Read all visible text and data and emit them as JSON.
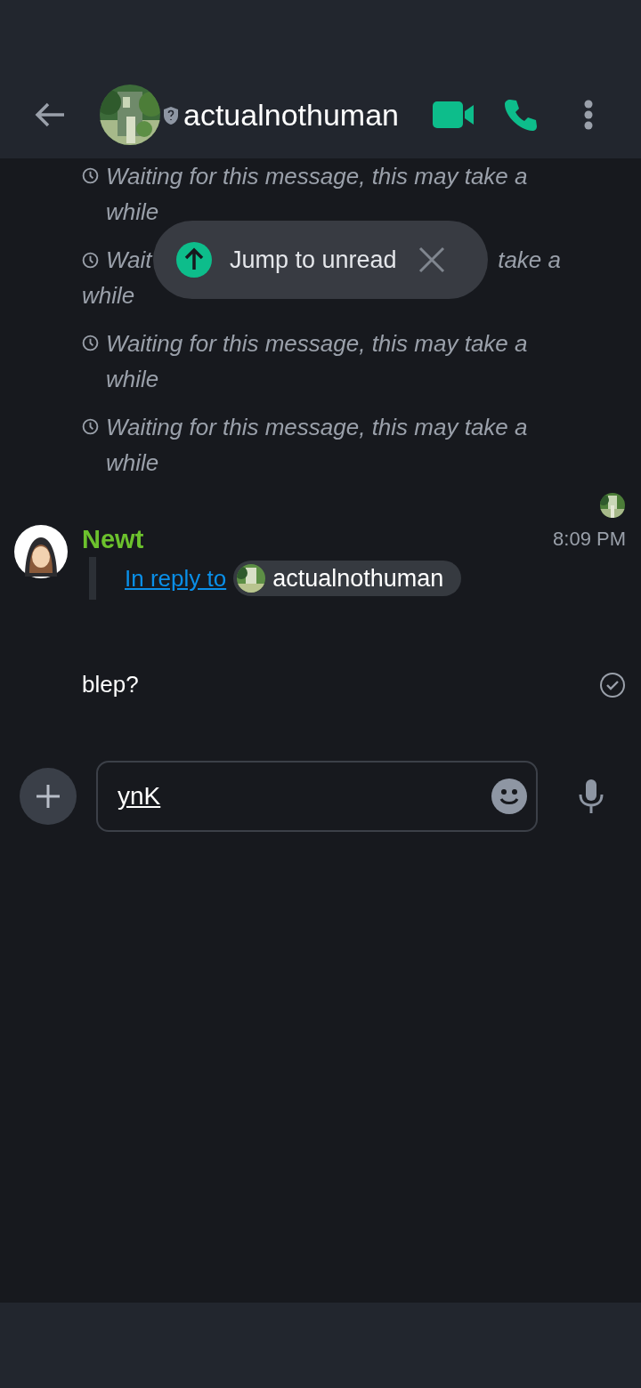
{
  "header": {
    "title": "actualnothuman"
  },
  "toast": {
    "label": "Jump to unread"
  },
  "pending_messages": [
    {
      "kind": "full",
      "text": "Waiting for this message, this may take a while"
    },
    {
      "kind": "covered",
      "start": "Wait",
      "end": "take a",
      "line_2": "while"
    },
    {
      "kind": "full",
      "text": "Waiting for this message, this may take a while"
    },
    {
      "kind": "full",
      "text": "Waiting for this message, this may take a while"
    }
  ],
  "message": {
    "sender": "Newt",
    "time": "8:09 PM",
    "reply": {
      "link": "In reply to",
      "user": "actualnothuman"
    },
    "body": "blep?",
    "sent": true
  },
  "composer": {
    "value": "ynK"
  }
}
